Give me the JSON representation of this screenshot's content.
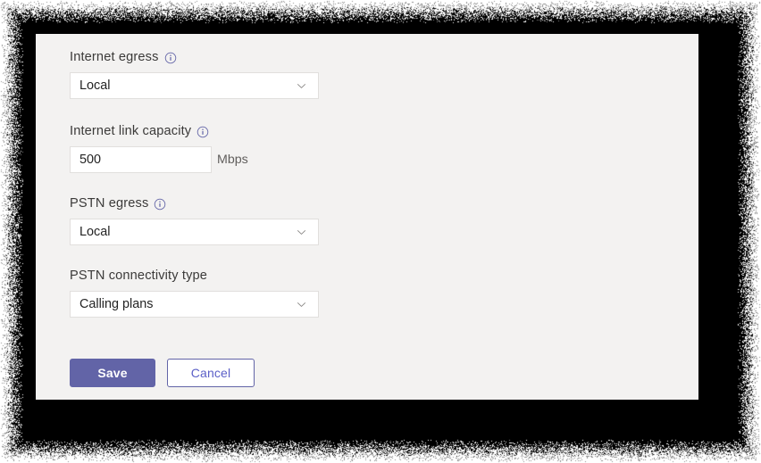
{
  "card": {
    "background_color": "#F3F2F1"
  },
  "colors": {
    "brand_purple": "#6264A7",
    "secondary_text": "#5B5FC7",
    "field_border": "#E1DFDD",
    "label_text": "#3B3A39",
    "backdrop": "#000000"
  },
  "form": {
    "fields": [
      {
        "id": "internet-egress",
        "label": "Internet egress",
        "has_info_icon": true,
        "info_icon_name": "info-icon",
        "control": "select",
        "value": "Local",
        "options": [
          "Local"
        ]
      },
      {
        "id": "internet-link-capacity",
        "label": "Internet link capacity",
        "has_info_icon": true,
        "info_icon_name": "info-icon",
        "control": "text",
        "value": "500",
        "placeholder": "",
        "unit": "Mbps"
      },
      {
        "id": "pstn-egress",
        "label": "PSTN egress",
        "has_info_icon": true,
        "info_icon_name": "info-icon",
        "control": "select",
        "value": "Local",
        "options": [
          "Local"
        ]
      },
      {
        "id": "pstn-connectivity-type",
        "label": "PSTN connectivity type",
        "has_info_icon": false,
        "control": "select",
        "value": "Calling plans",
        "options": [
          "Calling plans"
        ]
      }
    ],
    "actions": {
      "save_label": "Save",
      "cancel_label": "Cancel"
    }
  }
}
